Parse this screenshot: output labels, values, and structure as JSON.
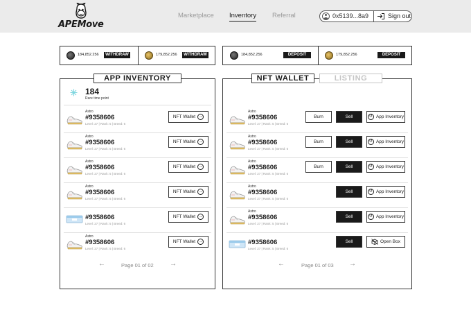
{
  "app": {
    "logo_text": "APEMove"
  },
  "nav": [
    {
      "label": "Marketplace",
      "active": false
    },
    {
      "label": "Inventory",
      "active": true
    },
    {
      "label": "Referral",
      "active": false
    }
  ],
  "account": {
    "address": "0x5139...8a9",
    "sign_out": "Sign out"
  },
  "balances": {
    "app": [
      {
        "amount": "184,852.256",
        "action": "WITHDRAW",
        "token_icon": "ape-token-icon"
      },
      {
        "amount": "179,852.256",
        "action": "WITHDRAW",
        "token_icon": "gold-token-icon"
      }
    ],
    "wallet": [
      {
        "amount": "184,852.256",
        "action": "DEPOSIT",
        "token_icon": "ape-token-icon"
      },
      {
        "amount": "179,852.256",
        "action": "DEPOSIT",
        "token_icon": "gold-token-icon"
      }
    ]
  },
  "tabs": {
    "app_inventory": "APP INVENTORY",
    "nft_wallet": "NFT WALLET",
    "listing": "LISTING"
  },
  "rare": {
    "value": "184",
    "label": "Rare time point"
  },
  "app_inventory": {
    "items": [
      {
        "type": "Astro",
        "id": "#9358606",
        "stats": "Level: 27 | Rank: 5 | Breed: 6",
        "image": "sneaker-white",
        "action": "NFT Wallet"
      },
      {
        "type": "Astro",
        "id": "#9358606",
        "stats": "Level: 27 | Rank: 5 | Breed: 6",
        "image": "sneaker-white",
        "action": "NFT Wallet"
      },
      {
        "type": "Astro",
        "id": "#9358606",
        "stats": "Level: 27 | Rank: 5 | Breed: 6",
        "image": "sneaker-white",
        "action": "NFT Wallet"
      },
      {
        "type": "Astro",
        "id": "#9358606",
        "stats": "Level: 27 | Rank: 5 | Breed: 6",
        "image": "sneaker-white",
        "action": "NFT Wallet"
      },
      {
        "type": "",
        "id": "#9358606",
        "stats": "Level: 27 | Rank: 5 | Breed: 6",
        "image": "shoebox-blue",
        "action": "NFT Wallet"
      },
      {
        "type": "Astro",
        "id": "#9358606",
        "stats": "Level: 27 | Rank: 5 | Breed: 6",
        "image": "sneaker-white",
        "action": "NFT Wallet"
      }
    ],
    "pager": "Page 01 of 02"
  },
  "nft_wallet": {
    "items": [
      {
        "type": "Astro",
        "id": "#9358606",
        "stats": "Level: 27 | Rank: 5 | Breed: 6",
        "image": "sneaker-white",
        "burn": "Burn",
        "sell": "Sell",
        "action": "App Inventory"
      },
      {
        "type": "Astro",
        "id": "#9358606",
        "stats": "Level: 27 | Rank: 5 | Breed: 6",
        "image": "sneaker-white",
        "burn": "Burn",
        "sell": "Sell",
        "action": "App Inventory"
      },
      {
        "type": "Astro",
        "id": "#9358606",
        "stats": "Level: 27 | Rank: 5 | Breed: 6",
        "image": "sneaker-white",
        "burn": "Burn",
        "sell": "Sell",
        "action": "App Inventory"
      },
      {
        "type": "Astro",
        "id": "#9358606",
        "stats": "Level: 27 | Rank: 5 | Breed: 6",
        "image": "sneaker-white",
        "burn": "",
        "sell": "Sell",
        "action": "App Inventory"
      },
      {
        "type": "Astro",
        "id": "#9358606",
        "stats": "Level: 27 | Rank: 5 | Breed: 6",
        "image": "sneaker-white",
        "burn": "",
        "sell": "Sell",
        "action": "App Inventory"
      },
      {
        "type": "",
        "id": "#9358606",
        "stats": "Level: 27 | Rank: 5 | Breed: 6",
        "image": "shoebox-blue",
        "burn": "",
        "sell": "Sell",
        "action": "Open Box"
      }
    ],
    "pager": "Page 01 of 03"
  },
  "icons": {
    "prev": "←",
    "next": "→",
    "arrow_circle": "→"
  },
  "colors": {
    "topbar": "#ebebeb",
    "ink": "#1a1a1a",
    "muted": "#9a9a9a",
    "accent_rare": "#7ed6df"
  }
}
